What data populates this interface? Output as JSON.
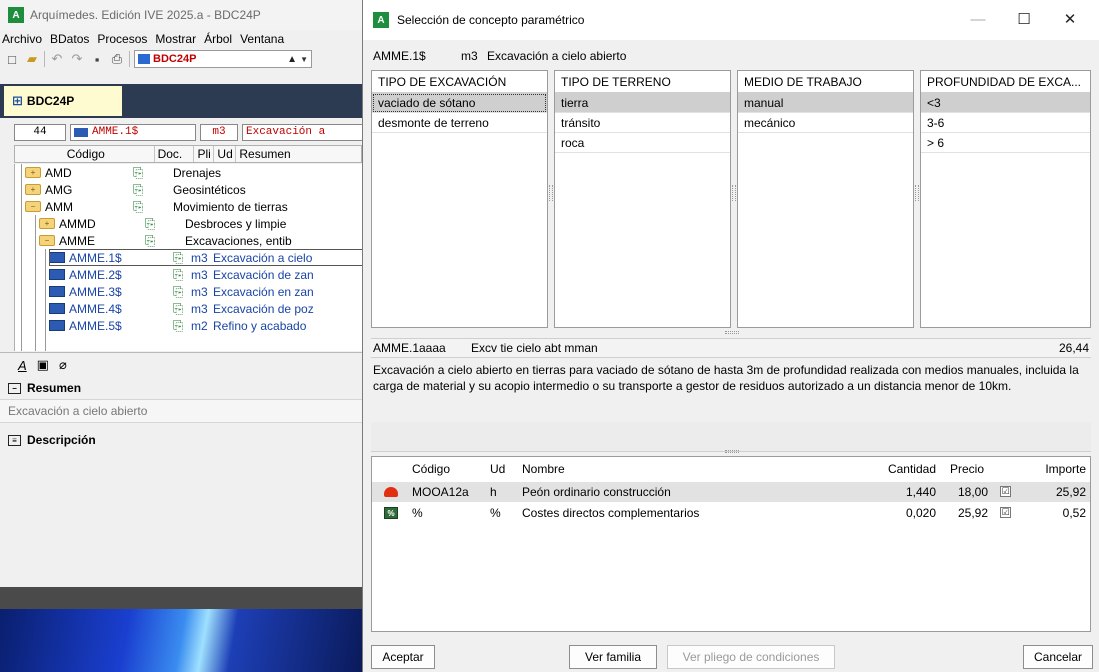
{
  "main_window": {
    "title": "Arquímedes. Edición IVE 2025.a - BDC24P",
    "menu": [
      "Archivo",
      "BDatos",
      "Procesos",
      "Mostrar",
      "Árbol",
      "Ventana"
    ],
    "db_select": "BDC24P",
    "doc_tab": "BDC24P",
    "code_row": {
      "count": "44",
      "code": "AMME.1$",
      "unit": "m3",
      "summary": "Excavación a"
    },
    "tree_columns": {
      "code": "Código",
      "doc": "Doc.",
      "pli": "Pli",
      "ud": "Ud",
      "summary": "Resumen"
    },
    "tree_rows": [
      {
        "code": "AMD",
        "ud": "",
        "summary": "Drenajes"
      },
      {
        "code": "AMG",
        "ud": "",
        "summary": "Geosintéticos"
      },
      {
        "code": "AMM",
        "ud": "",
        "summary": "Movimiento de tierras"
      },
      {
        "code": "AMMD",
        "ud": "",
        "summary": "Desbroces y limpie"
      },
      {
        "code": "AMME",
        "ud": "",
        "summary": "Excavaciones, entib"
      },
      {
        "code": "AMME.1$",
        "ud": "m3",
        "summary": "Excavación a cielo"
      },
      {
        "code": "AMME.2$",
        "ud": "m3",
        "summary": "Excavación de zan"
      },
      {
        "code": "AMME.3$",
        "ud": "m3",
        "summary": "Excavación en zan"
      },
      {
        "code": "AMME.4$",
        "ud": "m3",
        "summary": "Excavación de poz"
      },
      {
        "code": "AMME.5$",
        "ud": "m2",
        "summary": "Refino y acabado"
      }
    ],
    "resumen_label": "Resumen",
    "resumen_text": "Excavación a cielo abierto",
    "descripcion_label": "Descripción"
  },
  "dialog": {
    "title": "Selección de concepto paramétrico",
    "concept": {
      "code": "AMME.1$",
      "unit": "m3",
      "summary": "Excavación a cielo abierto"
    },
    "params": [
      {
        "header": "TIPO DE EXCAVACIÓN",
        "items": [
          "vaciado de sótano",
          "desmonte de terreno"
        ],
        "selected": 0
      },
      {
        "header": "TIPO DE TERRENO",
        "items": [
          "tierra",
          "tránsito",
          "roca"
        ],
        "selected": 0
      },
      {
        "header": "MEDIO DE TRABAJO",
        "items": [
          "manual",
          "mecánico"
        ],
        "selected": 0
      },
      {
        "header": "PROFUNDIDAD DE EXCA...",
        "items": [
          "<3",
          "3-6",
          "> 6"
        ],
        "selected": 0
      }
    ],
    "result": {
      "code": "AMME.1aaaa",
      "summary": "Excv tie cielo abt mman",
      "price": "26,44",
      "description": "Excavación a cielo abierto en tierras para vaciado de sótano de hasta 3m de profundidad realizada con medios manuales, incluida la carga de material y su acopio intermedio o su transporte a gestor de residuos autorizado a un distancia menor de 10km."
    },
    "decomposition": {
      "headers": {
        "code": "Código",
        "ud": "Ud",
        "name": "Nombre",
        "qty": "Cantidad",
        "price": "Precio",
        "amount": "Importe"
      },
      "rows": [
        {
          "icon": "helmet-icon",
          "code": "MOOA12a",
          "ud": "h",
          "name": "Peón ordinario construcción",
          "qty": "1,440",
          "price": "18,00",
          "checked": "☑",
          "amount": "25,92"
        },
        {
          "icon": "percent-icon",
          "icon_text": "%",
          "code": "%",
          "ud": "%",
          "name": "Costes directos complementarios",
          "qty": "0,020",
          "price": "25,92",
          "checked": "☑",
          "amount": "0,52"
        }
      ]
    },
    "buttons": {
      "accept": "Aceptar",
      "family": "Ver familia",
      "conditions": "Ver pliego de condiciones",
      "cancel": "Cancelar"
    },
    "colors": {
      "selected_row": "#cfcfcf",
      "concept_blue": "#1a44a6",
      "red_text": "#c00000"
    }
  }
}
